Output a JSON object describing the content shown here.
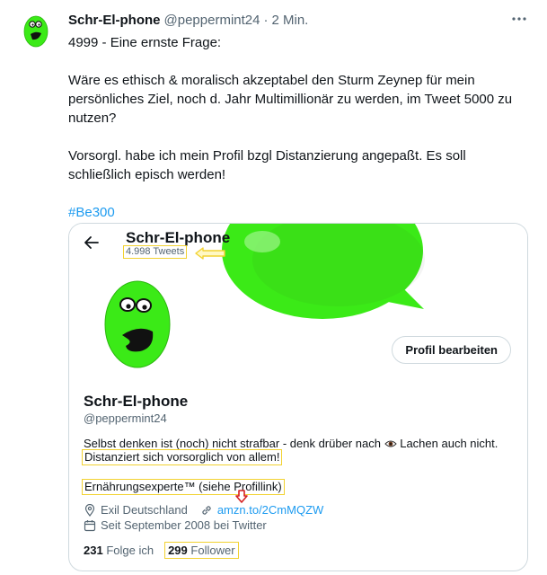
{
  "tweet": {
    "display_name": "Schr-El-phone",
    "handle": "@peppermint24",
    "separator": "·",
    "time": "2 Min.",
    "lines": [
      "4999 - Eine ernste Frage:",
      "",
      "Wäre es ethisch & moralisch akzeptabel den Sturm Zeynep für mein",
      "persönliches Ziel, noch d. Jahr Multimillionär zu werden, im Tweet 5000 zu",
      "nutzen?",
      "",
      "Vorsorgl. habe ich mein Profil bzgl Distanzierung angepaßt. Es soll",
      "schließlich episch werden!",
      ""
    ],
    "hashtag": "#Be300"
  },
  "card": {
    "name": "Schr-El-phone",
    "tweet_count": "4.998 Tweets",
    "edit_button": "Profil bearbeiten",
    "profile_name": "Schr-El-phone",
    "profile_handle": "@peppermint24",
    "bio_line1": "Selbst denken ist (noch) nicht strafbar - denk drüber nach",
    "bio_line1_end": "Lachen auch nicht.",
    "bio_line2": "Distanziert sich vorsorglich von allem!",
    "bio_line3": "Ernährungsexperte™ (siehe Profillink)",
    "location": "Exil Deutschland",
    "link": "amzn.to/2CmMQZW",
    "joined": "Seit September 2008 bei Twitter",
    "following_count": "231",
    "following_label": "Folge ich",
    "followers_count": "299",
    "followers_label": "Follower"
  },
  "colors": {
    "accent": "#1d9bf0",
    "highlight": "#f2d231",
    "avatar_green": "#3bea17",
    "secondary_text": "#536471"
  },
  "icons": [
    "more-icon",
    "back-icon",
    "location-icon",
    "link-icon",
    "calendar-icon",
    "eye-icon"
  ]
}
